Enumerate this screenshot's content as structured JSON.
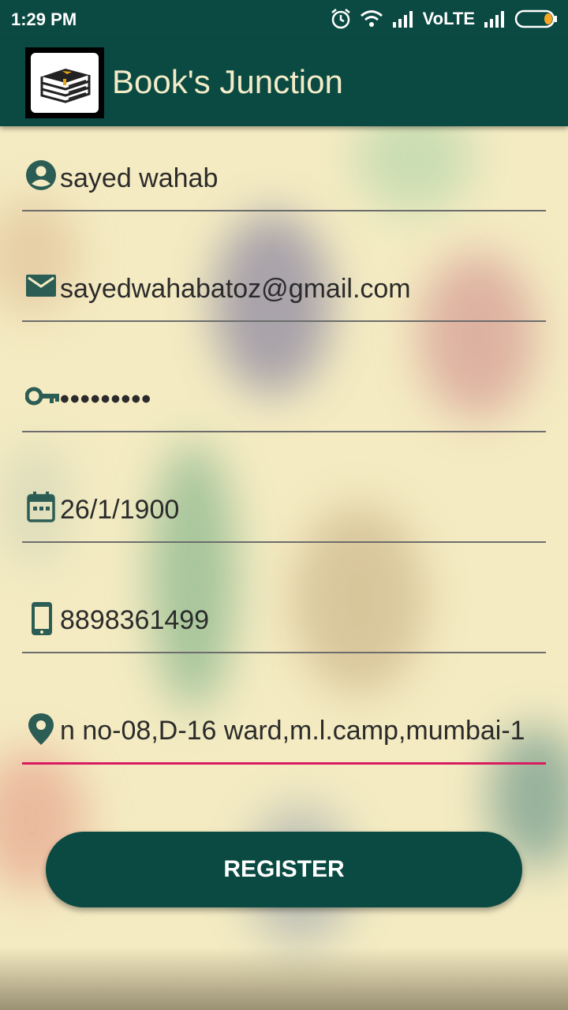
{
  "status_bar": {
    "time": "1:29 PM",
    "network": "VoLTE",
    "icons": [
      "alarm-icon",
      "wifi-icon",
      "signal-icon",
      "signal-icon",
      "battery-icon"
    ]
  },
  "app_bar": {
    "title": "Book's Junction",
    "logo_icon": "books-stack-icon"
  },
  "form": {
    "name": {
      "icon": "person-icon",
      "value": "sayed wahab"
    },
    "email": {
      "icon": "email-icon",
      "value": "sayedwahabatoz@gmail.com"
    },
    "password": {
      "icon": "key-icon",
      "value": "•••••••••"
    },
    "dob": {
      "icon": "calendar-icon",
      "value": "26/1/1900"
    },
    "phone": {
      "icon": "phone-icon",
      "value": "8898361499"
    },
    "address": {
      "icon": "location-pin-icon",
      "value": "n no-08,D-16 ward,m.l.camp,mumbai-1"
    }
  },
  "register_button": {
    "label": "REGISTER"
  },
  "colors": {
    "primary": "#0b4a42",
    "accent": "#d81b60",
    "title_text": "#f4ecc8"
  }
}
